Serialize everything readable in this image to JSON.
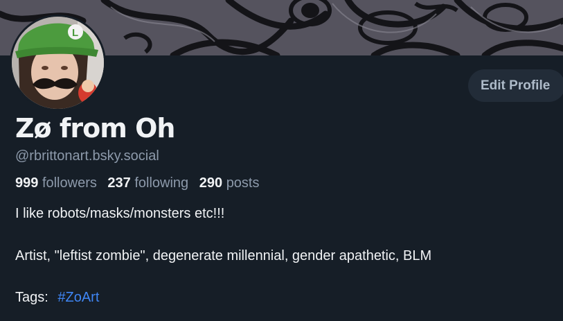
{
  "profile": {
    "display_name": "Zø from Oh",
    "handle": "@rbrittonart.bsky.social",
    "edit_label": "Edit Profile",
    "stats": {
      "followers_count": "999",
      "followers_label": "followers",
      "following_count": "237",
      "following_label": "following",
      "posts_count": "290",
      "posts_label": "posts"
    },
    "bio": {
      "line1": "I like robots/masks/monsters etc!!!",
      "line2": "Artist, \"leftist zombie\", degenerate millennial, gender apathetic, BLM",
      "tags_label": "Tags:",
      "tag": "#ZoArt"
    }
  },
  "colors": {
    "background": "#161e27",
    "muted_text": "#8d9aab",
    "link": "#3f86f5",
    "button_bg": "#222c38"
  }
}
